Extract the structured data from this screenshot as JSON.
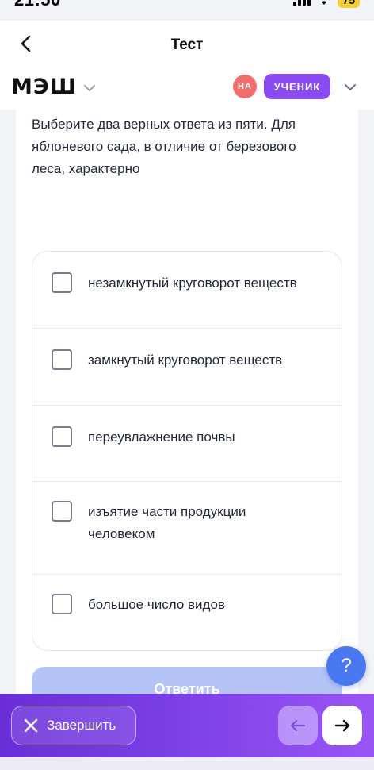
{
  "status_bar": {
    "time": "21:50",
    "battery": "75"
  },
  "header": {
    "title": "Тест"
  },
  "brand": {
    "logo": "МЭШ",
    "avatar_initials": "НА",
    "role": "УЧЕНИК"
  },
  "question": {
    "text": "Выберите два верных ответа из пяти. Для яблоневого сада, в отличие от березового леса, характерно"
  },
  "options": [
    {
      "label": "незамкнутый круговорот веществ",
      "checked": false
    },
    {
      "label": "замкнутый круговорот веществ",
      "checked": false
    },
    {
      "label": "переувлажнение почвы",
      "checked": false
    },
    {
      "label": "изъятие части продукции человеком",
      "checked": false
    },
    {
      "label": "большое число видов",
      "checked": false
    }
  ],
  "answer_button": {
    "label": "Ответить"
  },
  "help_button": {
    "label": "?"
  },
  "footer": {
    "finish_label": "Завершить"
  },
  "colors": {
    "accent": "#8a4bf2",
    "avatar": "#f36d6d",
    "help": "#4a78f0",
    "answer_disabled": "#b5c4f6"
  },
  "icons": {
    "back": "chevron-left-icon",
    "logo_menu": "chevron-down-icon",
    "role_menu": "chevron-down-icon",
    "finish": "close-icon",
    "prev": "arrow-left-icon",
    "next": "arrow-right-icon"
  }
}
